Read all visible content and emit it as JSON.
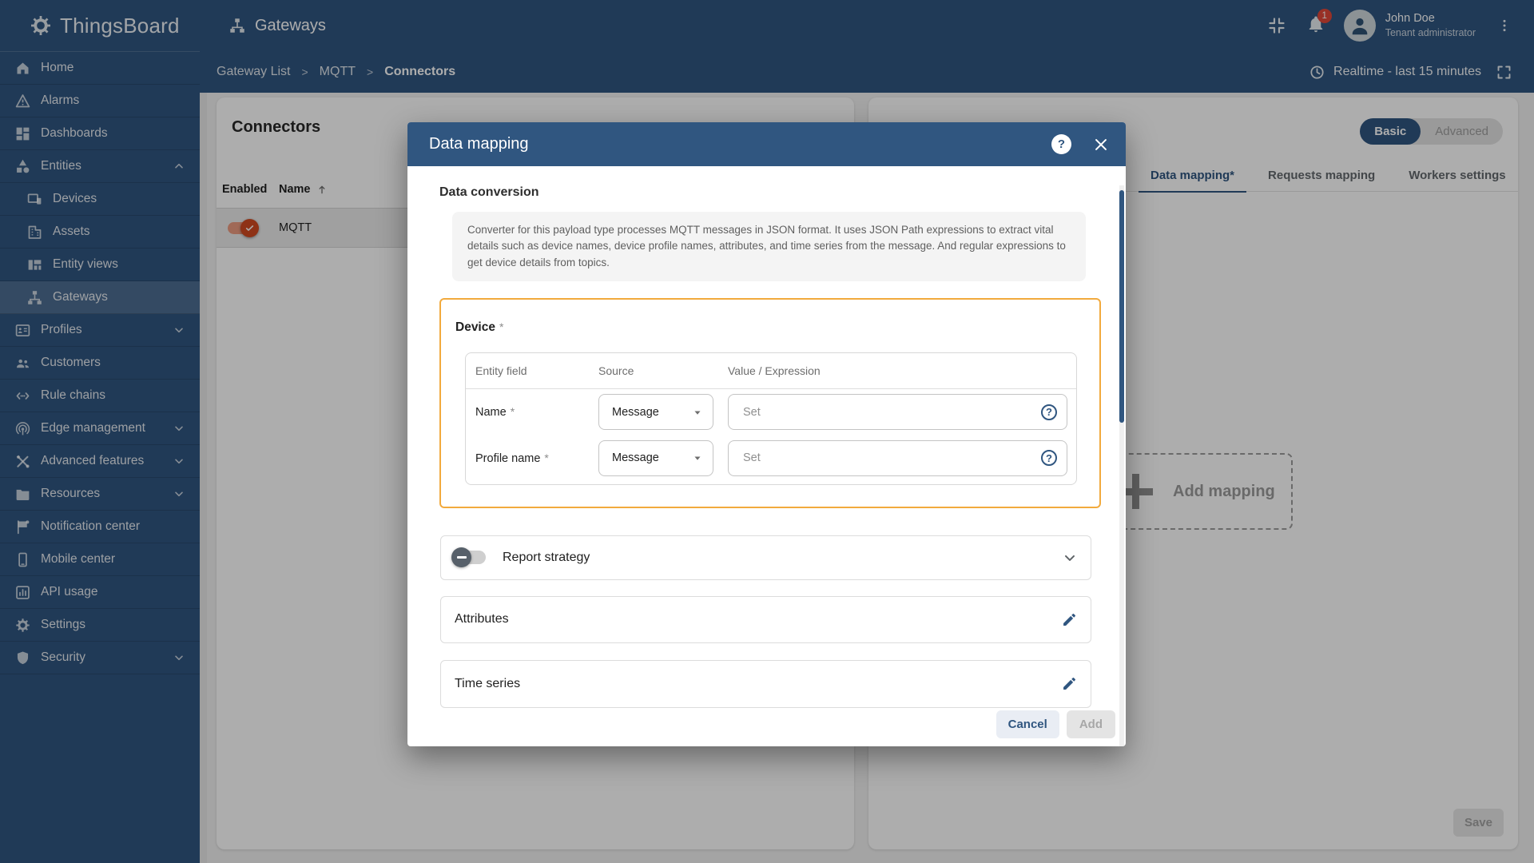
{
  "app": {
    "name": "ThingsBoard"
  },
  "colors": {
    "primary": "#305680",
    "device_highlight_border": "#f2aa3d",
    "enabled_toggle": "#d14a21",
    "badge_red": "#e04839"
  },
  "topbar": {
    "page_title": "Gateways",
    "notification_count": "1",
    "user": {
      "name": "John Doe",
      "role": "Tenant administrator"
    }
  },
  "breadcrumb": {
    "items": [
      "Gateway List",
      "MQTT",
      "Connectors"
    ],
    "separator": ">"
  },
  "time_window": {
    "label": "Realtime - last 15 minutes"
  },
  "sidebar": {
    "items": [
      {
        "label": "Home",
        "icon": "home"
      },
      {
        "label": "Alarms",
        "icon": "alarms"
      },
      {
        "label": "Dashboards",
        "icon": "dashboards"
      },
      {
        "label": "Entities",
        "icon": "entities",
        "chevron": "up"
      },
      {
        "label": "Devices",
        "icon": "devices",
        "indent": true
      },
      {
        "label": "Assets",
        "icon": "assets",
        "indent": true
      },
      {
        "label": "Entity views",
        "icon": "entity-views",
        "indent": true
      },
      {
        "label": "Gateways",
        "icon": "gateways",
        "indent": true,
        "active": true
      },
      {
        "label": "Profiles",
        "icon": "profiles",
        "chevron": "down"
      },
      {
        "label": "Customers",
        "icon": "customers"
      },
      {
        "label": "Rule chains",
        "icon": "rule-chains"
      },
      {
        "label": "Edge management",
        "icon": "edge-management",
        "chevron": "down"
      },
      {
        "label": "Advanced features",
        "icon": "advanced-features",
        "chevron": "down"
      },
      {
        "label": "Resources",
        "icon": "resources",
        "chevron": "down"
      },
      {
        "label": "Notification center",
        "icon": "notification-center"
      },
      {
        "label": "Mobile center",
        "icon": "mobile-center"
      },
      {
        "label": "API usage",
        "icon": "api-usage"
      },
      {
        "label": "Settings",
        "icon": "settings"
      },
      {
        "label": "Security",
        "icon": "security",
        "chevron": "down"
      }
    ]
  },
  "connectors_panel": {
    "title": "Connectors",
    "columns": {
      "enabled": "Enabled",
      "name": "Name"
    },
    "rows": [
      {
        "name": "MQTT",
        "enabled": true,
        "selected": true
      }
    ]
  },
  "gateway_panel": {
    "mode_toggle": {
      "options": [
        "Basic",
        "Advanced"
      ],
      "selected": "Basic"
    },
    "tabs": [
      {
        "label": "Data mapping*",
        "active": true
      },
      {
        "label": "Requests mapping",
        "active": false
      },
      {
        "label": "Workers settings",
        "active": false
      }
    ],
    "add_mapping_label": "Add mapping",
    "save_label": "Save"
  },
  "modal": {
    "title": "Data mapping",
    "help_glyph": "?",
    "section_title": "Data conversion",
    "info_text": "Converter for this payload type processes MQTT messages in JSON format. It uses JSON Path expressions to extract vital details such as device names, device profile names, attributes, and time series from the message. And regular expressions to get device details from topics.",
    "required_marker": "*",
    "device": {
      "title": "Device",
      "columns": [
        "Entity field",
        "Source",
        "Value / Expression"
      ],
      "rows": [
        {
          "field": "Name",
          "source": "Message",
          "value": "",
          "placeholder": "Set"
        },
        {
          "field": "Profile name",
          "source": "Message",
          "value": "",
          "placeholder": "Set"
        }
      ]
    },
    "report_strategy": {
      "label": "Report strategy",
      "enabled": false
    },
    "attributes_label": "Attributes",
    "time_series_label": "Time series",
    "cancel_label": "Cancel",
    "add_label": "Add"
  }
}
